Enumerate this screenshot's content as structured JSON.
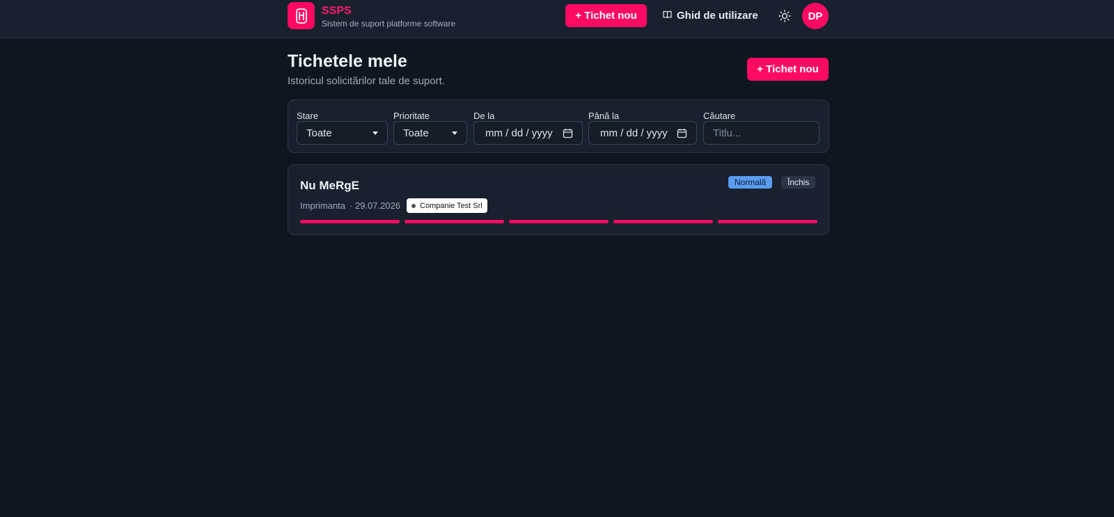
{
  "header": {
    "brand_name": "SSPS",
    "brand_subtitle": "Sistem de suport platforme software",
    "new_ticket_label": "+ Tichet nou",
    "guide_label": "Ghid de utilizare",
    "avatar_initials": "DP"
  },
  "page": {
    "title": "Tichetele mele",
    "subtitle": "Istoricul solicitărilor tale de suport.",
    "new_ticket_label": "+ Tichet nou"
  },
  "filters": {
    "status_label": "Stare",
    "status_value": "Toate",
    "priority_label": "Prioritate",
    "priority_value": "Toate",
    "from_label": "De la",
    "from_value": "mm / dd / yyyy",
    "to_label": "Până la",
    "to_value": "mm / dd / yyyy",
    "search_label": "Căutare",
    "search_placeholder": "Titlu..."
  },
  "tickets": [
    {
      "title": "Nu MeRgE",
      "category": "Imprimanta",
      "date": "· 29.07.2026",
      "company": "Companie Test Srl",
      "priority": "Normală",
      "status": "Închis",
      "progress_steps_total": 5,
      "progress_steps_done": 5
    }
  ],
  "colors": {
    "accent": "#ff0a63",
    "background": "#0e1620",
    "surface": "#18212d",
    "priority_badge": "#5a9cf0"
  }
}
